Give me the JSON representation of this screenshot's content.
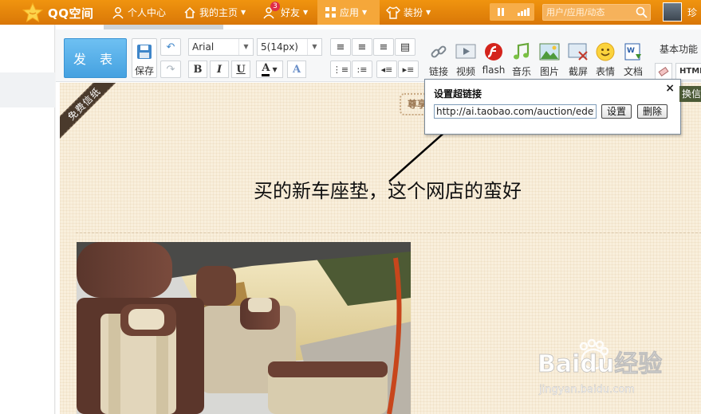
{
  "nav": {
    "logo_text": "QQ空间",
    "items": [
      {
        "label": "个人中心",
        "icon": "person-icon"
      },
      {
        "label": "我的主页",
        "icon": "home-icon"
      },
      {
        "label": "好友",
        "icon": "friends-icon",
        "badge": "3"
      },
      {
        "label": "应用",
        "icon": "apps-icon"
      },
      {
        "label": "装扮",
        "icon": "shirt-icon"
      }
    ],
    "search_placeholder": "用户/应用/动态",
    "user_name": "珍"
  },
  "toolbar": {
    "publish_label": "发 表",
    "save_label": "保存",
    "font_family": "Arial",
    "font_size": "5(14px)",
    "basic_functions_label": "基本功能",
    "html_label": "HTML",
    "insert_items": [
      {
        "label": "链接",
        "icon": "link-icon"
      },
      {
        "label": "视频",
        "icon": "video-icon"
      },
      {
        "label": "flash",
        "icon": "flash-icon"
      },
      {
        "label": "音乐",
        "icon": "music-icon"
      },
      {
        "label": "图片",
        "icon": "picture-icon"
      },
      {
        "label": "截屏",
        "icon": "screenshot-icon"
      },
      {
        "label": "表情",
        "icon": "emoticon-icon"
      },
      {
        "label": "文档",
        "icon": "document-icon"
      }
    ]
  },
  "content": {
    "ribbon_text": "免费信纸",
    "stamp_text": "尊享",
    "body_text": "买的新车座垫，这个网店的蛮好"
  },
  "link_dialog": {
    "title": "设置超链接",
    "url_value": "http://ai.taobao.com/auction/edetail",
    "set_label": "设置",
    "delete_label": "删除",
    "close_label": "×"
  },
  "side_tab_text": "换信",
  "watermark": {
    "brand": "Baidu经验",
    "url": "jingyan.baidu.com"
  },
  "colors": {
    "topbar": "#e3820b",
    "publish": "#59b1ea",
    "paper": "#f9efdc"
  }
}
